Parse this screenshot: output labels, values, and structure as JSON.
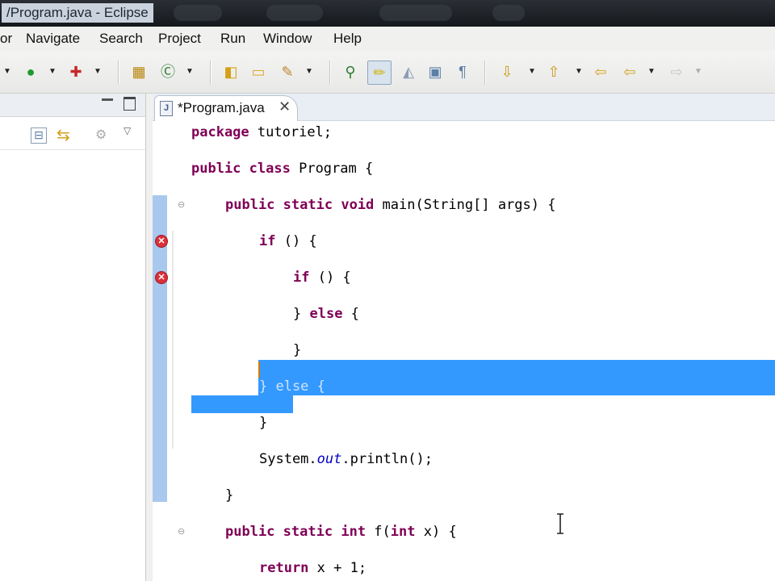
{
  "window": {
    "title": "/Program.java - Eclipse"
  },
  "menu": [
    "or",
    "Navigate",
    "Search",
    "Project",
    "Run",
    "Window",
    "Help"
  ],
  "editor": {
    "tab_label": "*Program.java",
    "lines": [
      "package tutoriel;",
      "public class Program {",
      "public static void main(String[] args) {",
      "if () {",
      "if () {",
      "} else {",
      "}",
      "} else {",
      "}",
      "System.out.println();",
      "}",
      "public static int f(int x) {",
      "return x + 1;"
    ]
  },
  "colors": {
    "keyword": "#7f0055",
    "selection": "#3399ff",
    "gutter_band": "#a9c8ee",
    "error_marker": "#d9303a",
    "field_italic": "#0000c0"
  },
  "icons": [
    "run-icon",
    "debug-icon",
    "new-class-icon",
    "open-type-icon",
    "search-icon",
    "mark-occurrences-icon",
    "next-annotation-icon",
    "back-icon",
    "forward-icon"
  ]
}
